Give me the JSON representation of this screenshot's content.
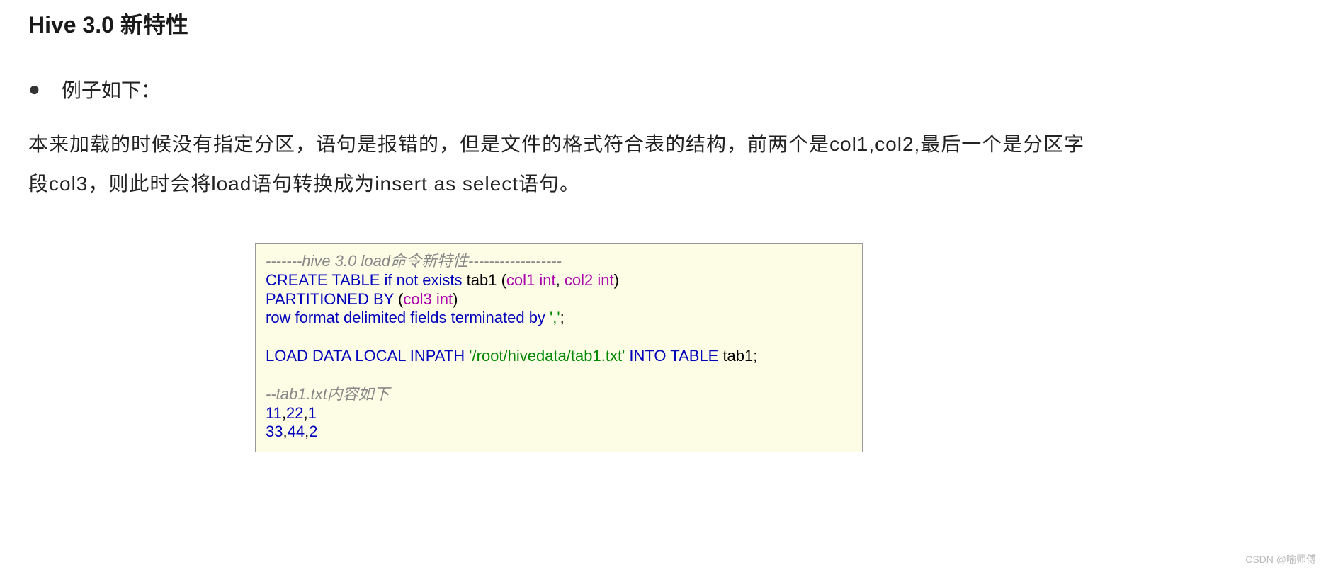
{
  "title": "Hive 3.0 新特性",
  "bullet": {
    "dot": "●",
    "text": "例子如下："
  },
  "paragraph": "本来加载的时候没有指定分区，语句是报错的，但是文件的格式符合表的结构，前两个是col1,col2,最后一个是分区字段col3，则此时会将load语句转换成为insert as select语句。",
  "code": {
    "l1_comment": "-------hive 3.0 load命令新特性------------------",
    "l2_a": "CREATE TABLE if not exists",
    "l2_b": " tab1 (",
    "l2_c": "col1 int",
    "l2_d": ", ",
    "l2_e": "col2 int",
    "l2_f": ")",
    "l3_a": "PARTITIONED BY",
    "l3_b": " (",
    "l3_c": "col3 int",
    "l3_d": ")",
    "l4_a": "row format delimited fields terminated by",
    "l4_b": " ','",
    "l4_c": ";",
    "l6_a": "LOAD DATA LOCAL INPATH",
    "l6_b": " '/root/hivedata/tab1.txt'",
    "l6_c": " INTO TABLE",
    "l6_d": " tab1;",
    "l8_comment": "--tab1.txt内容如下",
    "l9_a": "11",
    "l9_b": ",",
    "l9_c": "22",
    "l9_d": ",",
    "l9_e": "1",
    "l10_a": "33",
    "l10_b": ",",
    "l10_c": "44",
    "l10_d": ",",
    "l10_e": "2"
  },
  "watermark": "CSDN @喻师傅"
}
